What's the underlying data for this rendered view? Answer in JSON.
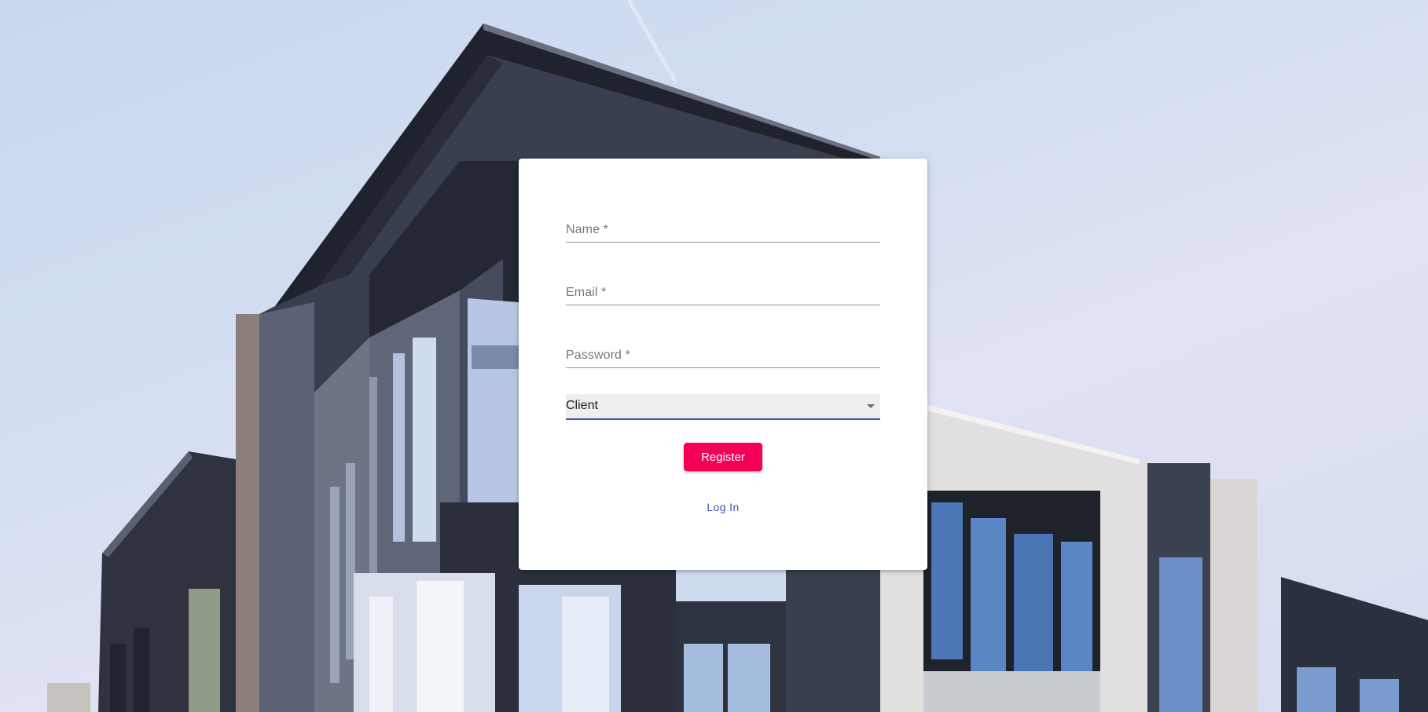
{
  "form": {
    "name_label": "Name *",
    "email_label": "Email *",
    "password_label": "Password *",
    "role_select": {
      "selected": "Client"
    },
    "register_label": "Register",
    "login_label": "Log In"
  },
  "colors": {
    "accent_pink": "#f50057",
    "primary_indigo": "#3f51b5",
    "card_background": "#ffffff"
  }
}
